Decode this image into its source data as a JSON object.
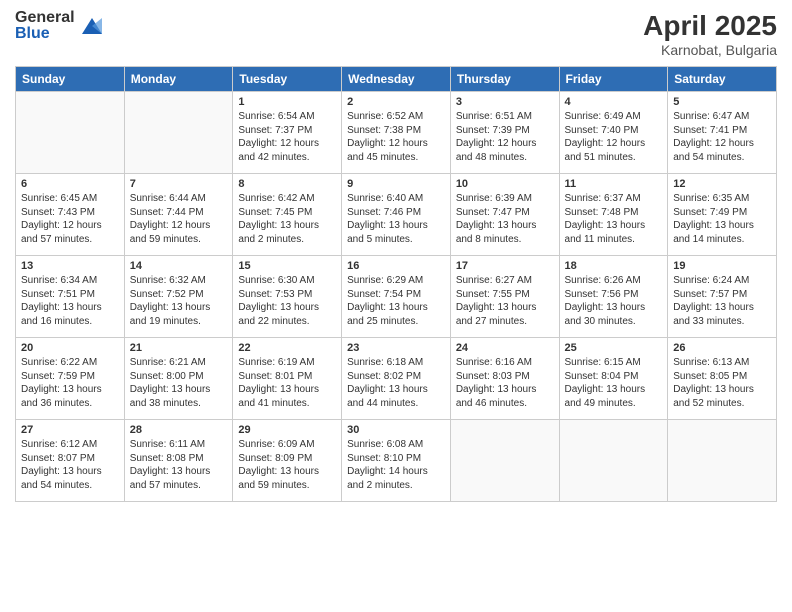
{
  "logo": {
    "general": "General",
    "blue": "Blue"
  },
  "header": {
    "title": "April 2025",
    "location": "Karnobat, Bulgaria"
  },
  "weekdays": [
    "Sunday",
    "Monday",
    "Tuesday",
    "Wednesday",
    "Thursday",
    "Friday",
    "Saturday"
  ],
  "weeks": [
    [
      {
        "day": "",
        "sunrise": "",
        "sunset": "",
        "daylight": ""
      },
      {
        "day": "",
        "sunrise": "",
        "sunset": "",
        "daylight": ""
      },
      {
        "day": "1",
        "sunrise": "Sunrise: 6:54 AM",
        "sunset": "Sunset: 7:37 PM",
        "daylight": "Daylight: 12 hours and 42 minutes."
      },
      {
        "day": "2",
        "sunrise": "Sunrise: 6:52 AM",
        "sunset": "Sunset: 7:38 PM",
        "daylight": "Daylight: 12 hours and 45 minutes."
      },
      {
        "day": "3",
        "sunrise": "Sunrise: 6:51 AM",
        "sunset": "Sunset: 7:39 PM",
        "daylight": "Daylight: 12 hours and 48 minutes."
      },
      {
        "day": "4",
        "sunrise": "Sunrise: 6:49 AM",
        "sunset": "Sunset: 7:40 PM",
        "daylight": "Daylight: 12 hours and 51 minutes."
      },
      {
        "day": "5",
        "sunrise": "Sunrise: 6:47 AM",
        "sunset": "Sunset: 7:41 PM",
        "daylight": "Daylight: 12 hours and 54 minutes."
      }
    ],
    [
      {
        "day": "6",
        "sunrise": "Sunrise: 6:45 AM",
        "sunset": "Sunset: 7:43 PM",
        "daylight": "Daylight: 12 hours and 57 minutes."
      },
      {
        "day": "7",
        "sunrise": "Sunrise: 6:44 AM",
        "sunset": "Sunset: 7:44 PM",
        "daylight": "Daylight: 12 hours and 59 minutes."
      },
      {
        "day": "8",
        "sunrise": "Sunrise: 6:42 AM",
        "sunset": "Sunset: 7:45 PM",
        "daylight": "Daylight: 13 hours and 2 minutes."
      },
      {
        "day": "9",
        "sunrise": "Sunrise: 6:40 AM",
        "sunset": "Sunset: 7:46 PM",
        "daylight": "Daylight: 13 hours and 5 minutes."
      },
      {
        "day": "10",
        "sunrise": "Sunrise: 6:39 AM",
        "sunset": "Sunset: 7:47 PM",
        "daylight": "Daylight: 13 hours and 8 minutes."
      },
      {
        "day": "11",
        "sunrise": "Sunrise: 6:37 AM",
        "sunset": "Sunset: 7:48 PM",
        "daylight": "Daylight: 13 hours and 11 minutes."
      },
      {
        "day": "12",
        "sunrise": "Sunrise: 6:35 AM",
        "sunset": "Sunset: 7:49 PM",
        "daylight": "Daylight: 13 hours and 14 minutes."
      }
    ],
    [
      {
        "day": "13",
        "sunrise": "Sunrise: 6:34 AM",
        "sunset": "Sunset: 7:51 PM",
        "daylight": "Daylight: 13 hours and 16 minutes."
      },
      {
        "day": "14",
        "sunrise": "Sunrise: 6:32 AM",
        "sunset": "Sunset: 7:52 PM",
        "daylight": "Daylight: 13 hours and 19 minutes."
      },
      {
        "day": "15",
        "sunrise": "Sunrise: 6:30 AM",
        "sunset": "Sunset: 7:53 PM",
        "daylight": "Daylight: 13 hours and 22 minutes."
      },
      {
        "day": "16",
        "sunrise": "Sunrise: 6:29 AM",
        "sunset": "Sunset: 7:54 PM",
        "daylight": "Daylight: 13 hours and 25 minutes."
      },
      {
        "day": "17",
        "sunrise": "Sunrise: 6:27 AM",
        "sunset": "Sunset: 7:55 PM",
        "daylight": "Daylight: 13 hours and 27 minutes."
      },
      {
        "day": "18",
        "sunrise": "Sunrise: 6:26 AM",
        "sunset": "Sunset: 7:56 PM",
        "daylight": "Daylight: 13 hours and 30 minutes."
      },
      {
        "day": "19",
        "sunrise": "Sunrise: 6:24 AM",
        "sunset": "Sunset: 7:57 PM",
        "daylight": "Daylight: 13 hours and 33 minutes."
      }
    ],
    [
      {
        "day": "20",
        "sunrise": "Sunrise: 6:22 AM",
        "sunset": "Sunset: 7:59 PM",
        "daylight": "Daylight: 13 hours and 36 minutes."
      },
      {
        "day": "21",
        "sunrise": "Sunrise: 6:21 AM",
        "sunset": "Sunset: 8:00 PM",
        "daylight": "Daylight: 13 hours and 38 minutes."
      },
      {
        "day": "22",
        "sunrise": "Sunrise: 6:19 AM",
        "sunset": "Sunset: 8:01 PM",
        "daylight": "Daylight: 13 hours and 41 minutes."
      },
      {
        "day": "23",
        "sunrise": "Sunrise: 6:18 AM",
        "sunset": "Sunset: 8:02 PM",
        "daylight": "Daylight: 13 hours and 44 minutes."
      },
      {
        "day": "24",
        "sunrise": "Sunrise: 6:16 AM",
        "sunset": "Sunset: 8:03 PM",
        "daylight": "Daylight: 13 hours and 46 minutes."
      },
      {
        "day": "25",
        "sunrise": "Sunrise: 6:15 AM",
        "sunset": "Sunset: 8:04 PM",
        "daylight": "Daylight: 13 hours and 49 minutes."
      },
      {
        "day": "26",
        "sunrise": "Sunrise: 6:13 AM",
        "sunset": "Sunset: 8:05 PM",
        "daylight": "Daylight: 13 hours and 52 minutes."
      }
    ],
    [
      {
        "day": "27",
        "sunrise": "Sunrise: 6:12 AM",
        "sunset": "Sunset: 8:07 PM",
        "daylight": "Daylight: 13 hours and 54 minutes."
      },
      {
        "day": "28",
        "sunrise": "Sunrise: 6:11 AM",
        "sunset": "Sunset: 8:08 PM",
        "daylight": "Daylight: 13 hours and 57 minutes."
      },
      {
        "day": "29",
        "sunrise": "Sunrise: 6:09 AM",
        "sunset": "Sunset: 8:09 PM",
        "daylight": "Daylight: 13 hours and 59 minutes."
      },
      {
        "day": "30",
        "sunrise": "Sunrise: 6:08 AM",
        "sunset": "Sunset: 8:10 PM",
        "daylight": "Daylight: 14 hours and 2 minutes."
      },
      {
        "day": "",
        "sunrise": "",
        "sunset": "",
        "daylight": ""
      },
      {
        "day": "",
        "sunrise": "",
        "sunset": "",
        "daylight": ""
      },
      {
        "day": "",
        "sunrise": "",
        "sunset": "",
        "daylight": ""
      }
    ]
  ]
}
